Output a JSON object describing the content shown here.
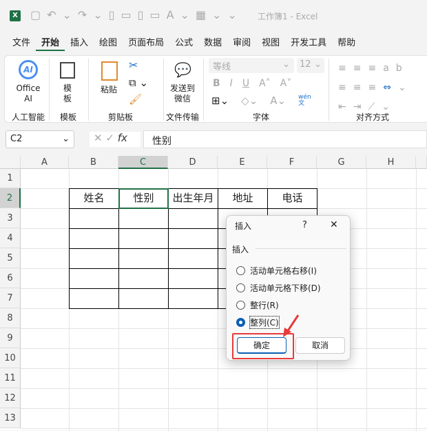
{
  "title": "工作簿1  -  Excel",
  "menu": [
    "文件",
    "开始",
    "插入",
    "绘图",
    "页面布局",
    "公式",
    "数据",
    "审阅",
    "视图",
    "开发工具",
    "帮助"
  ],
  "ribbon": {
    "office_ai": "Office AI",
    "ai_badge": "AI",
    "template": "模板",
    "paste": "粘贴",
    "send": "发送到微信",
    "font_name": "等线",
    "font_size": "12",
    "bold": "B",
    "italic": "I",
    "underline": "U",
    "wen": "wén",
    "wen2": "文",
    "groups": [
      "人工智能",
      "模板",
      "剪贴板",
      "文件传输",
      "字体",
      "对齐方式"
    ]
  },
  "formula": {
    "name_box": "C2",
    "fx": "fx",
    "value": "性别"
  },
  "columns": [
    "A",
    "B",
    "C",
    "D",
    "E",
    "F",
    "G",
    "H"
  ],
  "rows": [
    "1",
    "2",
    "3",
    "4",
    "5",
    "6",
    "7",
    "8",
    "9",
    "10",
    "11",
    "12",
    "13"
  ],
  "table_headers": [
    "姓名",
    "性别",
    "出生年月",
    "地址",
    "电话"
  ],
  "dialog": {
    "title": "插入",
    "help": "?",
    "close": "✕",
    "section": "插入",
    "options": [
      "活动单元格右移(I)",
      "活动单元格下移(D)",
      "整行(R)",
      "整列(C)"
    ],
    "selected": 3,
    "ok": "确定",
    "cancel": "取消"
  }
}
